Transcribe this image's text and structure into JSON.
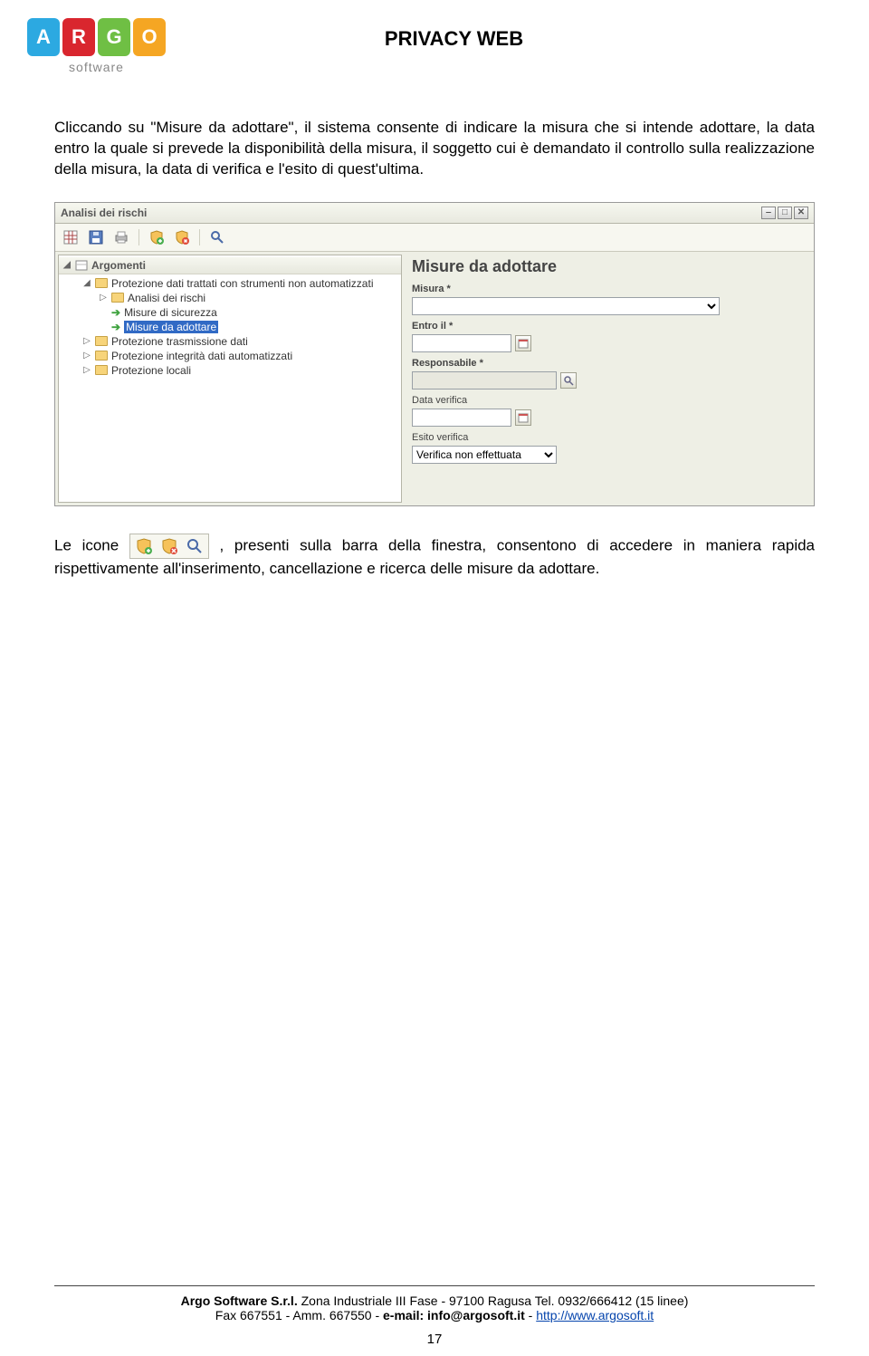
{
  "header": {
    "logo_text": "software",
    "logo_letters": [
      "A",
      "R",
      "G",
      "O"
    ],
    "title": "PRIVACY WEB"
  },
  "para1": "Cliccando su \"Misure da adottare\", il sistema consente di indicare la misura che si intende adottare, la data entro la quale si prevede la disponibilità della misura, il soggetto cui è demandato il controllo sulla realizzazione della misura, la  data di verifica e l'esito di quest'ultima.",
  "window": {
    "title": "Analisi dei rischi",
    "tree_root": "Argomenti",
    "tree": {
      "n0": {
        "label": "Protezione dati trattati con strumenti non automatizzati"
      },
      "n1": {
        "label": "Analisi dei rischi"
      },
      "n2": {
        "label": "Misure di sicurezza"
      },
      "n3": {
        "label": "Misure da adottare"
      },
      "n4": {
        "label": "Protezione trasmissione dati"
      },
      "n5": {
        "label": "Protezione integrità  dati automatizzati"
      },
      "n6": {
        "label": "Protezione locali"
      }
    },
    "form": {
      "title": "Misure da adottare",
      "labels": {
        "misura": "Misura *",
        "entro": "Entro il *",
        "responsabile": "Responsabile *",
        "data_verifica": "Data verifica",
        "esito": "Esito verifica"
      },
      "values": {
        "misura": "",
        "entro": "",
        "responsabile": "",
        "data_verifica": "",
        "esito": "Verifica non effettuata"
      }
    }
  },
  "para2_pre": "Le icone ",
  "para2_post": ", presenti sulla barra della finestra, consentono di accedere in maniera rapida rispettivamente all'inserimento, cancellazione e ricerca delle misure da adottare.",
  "footer": {
    "line1a": "Argo Software S.r.l.",
    "line1b": " Zona Industriale III Fase - 97100 Ragusa Tel. 0932/666412 (15 linee)",
    "line2a": "Fax 667551 - Amm. 667550 - ",
    "line2b": "e-mail: info@argosoft.it",
    "line2c": " - ",
    "link": "http://www.argosoft.it",
    "page": "17"
  }
}
